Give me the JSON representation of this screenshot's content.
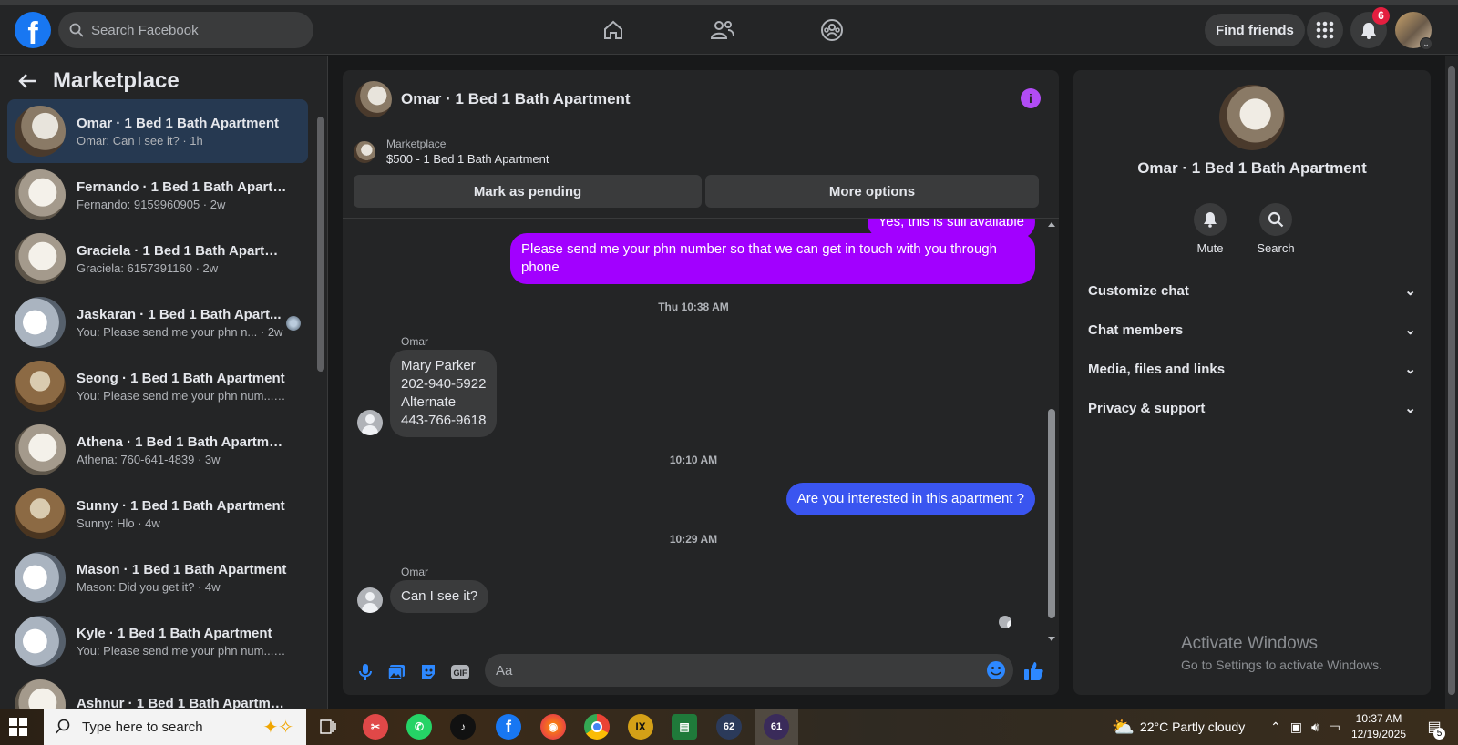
{
  "topbar": {
    "logo": "f",
    "search_placeholder": "Search Facebook",
    "find_friends": "Find friends",
    "notification_count": "6"
  },
  "sidebar": {
    "title": "Marketplace",
    "conversations": [
      {
        "name": "Omar · 1 Bed 1 Bath Apartment",
        "preview": "Omar: Can I see it? · 1h",
        "active": true
      },
      {
        "name": "Fernando · 1 Bed 1 Bath Apartm...",
        "preview": "Fernando: 9159960905 · 2w"
      },
      {
        "name": "Graciela · 1 Bed 1 Bath Apartment",
        "preview": "Graciela: 6157391160 · 2w"
      },
      {
        "name": "Jaskaran · 1 Bed 1 Bath Apart...",
        "preview": "You: Please send me your phn n...  · 2w"
      },
      {
        "name": "Seong · 1 Bed 1 Bath Apartment",
        "preview": "You: Please send me your phn num... · 3w"
      },
      {
        "name": "Athena · 1 Bed 1 Bath Apartment",
        "preview": "Athena: 760-641-4839 · 3w"
      },
      {
        "name": "Sunny · 1 Bed 1 Bath Apartment",
        "preview": "Sunny: Hlo · 4w"
      },
      {
        "name": "Mason · 1 Bed 1 Bath Apartment",
        "preview": "Mason: Did you get it? · 4w"
      },
      {
        "name": "Kyle · 1 Bed 1 Bath Apartment",
        "preview": "You: Please send me your phn num... · 4w"
      },
      {
        "name": "Ashnur · 1 Bed 1 Bath Apartment",
        "preview": ""
      }
    ]
  },
  "chat": {
    "title": "Omar · 1 Bed 1 Bath Apartment",
    "marketplace_label": "Marketplace",
    "listing": "$500 - 1 Bed 1 Bath Apartment",
    "mark_pending": "Mark as pending",
    "more_options": "More options",
    "partial_top_msg": "Yes, this is still available",
    "msg1": "Please send me your phn number so that we can get in touch with you through phone",
    "stamp1": "Thu 10:38 AM",
    "sender": "Omar",
    "msg2_lines": [
      "Mary Parker",
      "202-940-5922",
      "Alternate",
      "443-766-9618"
    ],
    "stamp2": "10:10 AM",
    "msg3": "Are you interested in this apartment ?",
    "stamp3": "10:29 AM",
    "msg4": "Can I see it?",
    "composer_placeholder": "Aa"
  },
  "details": {
    "title": "Omar · 1 Bed 1 Bath Apartment",
    "mute": "Mute",
    "search": "Search",
    "sections": [
      "Customize chat",
      "Chat members",
      "Media, files and links",
      "Privacy & support"
    ]
  },
  "watermark": {
    "line1": "Activate Windows",
    "line2": "Go to Settings to activate Windows."
  },
  "taskbar": {
    "search_placeholder": "Type here to search",
    "weather": "22°C  Partly cloudy",
    "time": "10:37 AM",
    "date": "12/19/2025",
    "badge_a": "62",
    "badge_b": "61",
    "notif_count": "5"
  },
  "colors": {
    "accent_purple": "#a200ff",
    "accent_blue": "#3a55f0",
    "fb_blue": "#1877f2"
  }
}
